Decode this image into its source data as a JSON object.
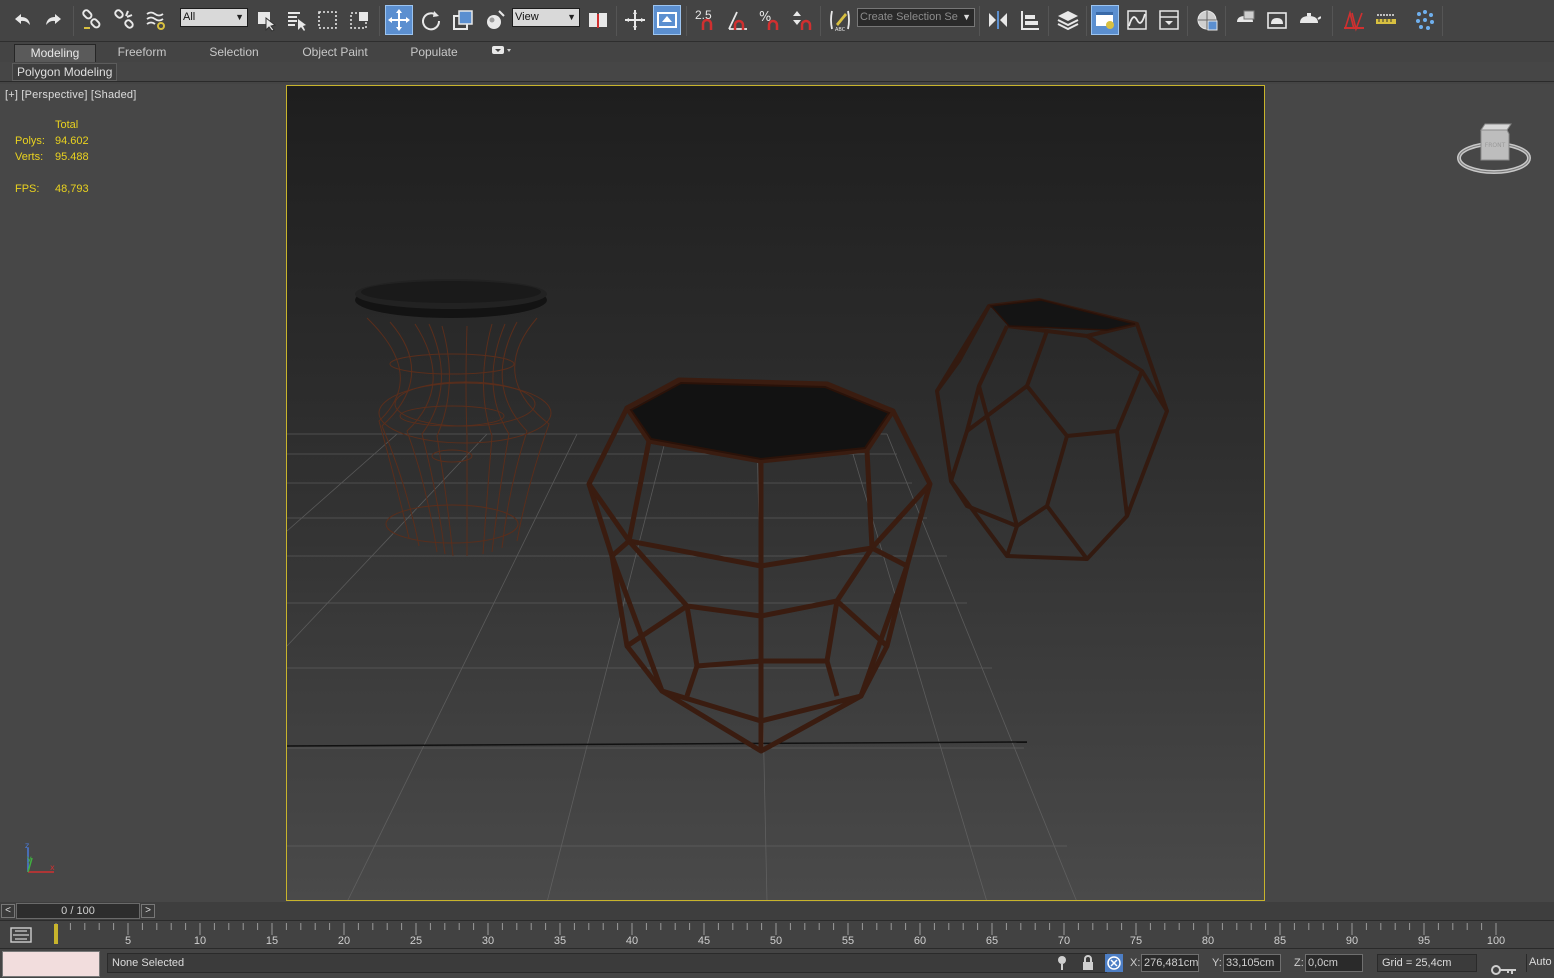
{
  "toolbar": {
    "selection_filter": "All",
    "reference_coordinate": "View",
    "angle_snap_value": "2.5",
    "named_selection_placeholder": "Create Selection Se",
    "icons": [
      "undo-icon",
      "redo-icon",
      "link-icon",
      "unlink-icon",
      "bind-space-warp-icon",
      "select-object-icon",
      "select-by-name-icon",
      "rectangular-selection-icon",
      "window-crossing-icon",
      "select-move-icon",
      "select-rotate-icon",
      "select-scale-icon",
      "select-place-icon",
      "select-mirror-icon",
      "align-icon",
      "layer-explorer-icon",
      "scene-explorer-icon",
      "curve-editor-icon",
      "schematic-view-icon",
      "material-editor-icon",
      "render-setup-icon",
      "rendered-frame-icon",
      "render-production-icon"
    ],
    "colors": {
      "active": "#5b8fd0",
      "background": "#444444"
    }
  },
  "ribbon": {
    "tabs": [
      "Modeling",
      "Freeform",
      "Selection",
      "Object Paint",
      "Populate"
    ],
    "active_tab": "Modeling",
    "panel_label": "Polygon Modeling"
  },
  "viewport": {
    "label": "[+] [Perspective] [Shaded]",
    "stats": {
      "total_label": "Total",
      "polys_label": "Polys:",
      "polys_value": "94.602",
      "verts_label": "Verts:",
      "verts_value": "95.488",
      "fps_label": "FPS:",
      "fps_value": "48,793"
    },
    "viewcube_face": "FRONT",
    "axis_labels": {
      "z": "z",
      "y": "y",
      "x": "x"
    },
    "colors": {
      "safe_frame": "#c8b42c",
      "stats": "#e9d21f",
      "wire": "#3a1c10"
    }
  },
  "time_slider": {
    "position_text": "0 / 100",
    "prev_label": "<",
    "next_label": ">"
  },
  "trackbar": {
    "ticks": [
      "0",
      "5",
      "10",
      "15",
      "20",
      "25",
      "30",
      "35",
      "40",
      "45",
      "50",
      "55",
      "60",
      "65",
      "70",
      "75",
      "80",
      "85",
      "90",
      "95",
      "100"
    ]
  },
  "status": {
    "selection_text": "None Selected",
    "x_label": "X:",
    "x_value": "276,481cm",
    "y_label": "Y:",
    "y_value": "33,105cm",
    "z_label": "Z:",
    "z_value": "0,0cm",
    "grid_text": "Grid = 25,4cm",
    "auto_label": "Auto"
  }
}
